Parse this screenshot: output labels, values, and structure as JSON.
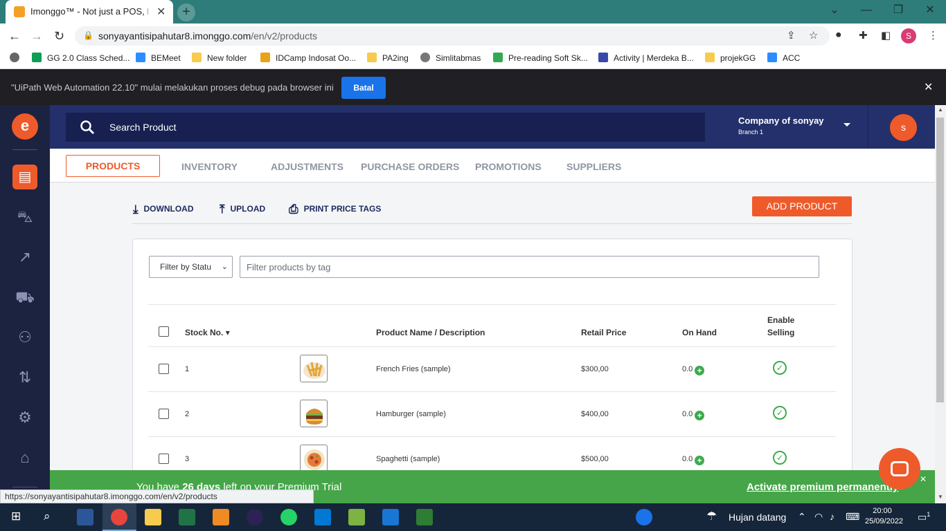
{
  "browser": {
    "tab_title": "Imonggo™ - Not just a POS, It's t",
    "url_main": "sonyayantisipahutar8.imonggo.com",
    "url_path": "/en/v2/products",
    "status_url": "https://sonyayantisipahutar8.imonggo.com/en/v2/products",
    "profile_initial": "S",
    "bookmarks": [
      {
        "label": "GG 2.0 Class Sched...",
        "color": "#0f9d58"
      },
      {
        "label": "BEMeet",
        "color": "#2d8cff"
      },
      {
        "label": "New folder",
        "color": "#f7cb4d"
      },
      {
        "label": "IDCamp Indosat Oo...",
        "color": "#e8a317"
      },
      {
        "label": "PA2ing",
        "color": "#f7cb4d"
      },
      {
        "label": "Simlitabmas",
        "color": "#777777"
      },
      {
        "label": "Pre-reading Soft Sk...",
        "color": "#34a853"
      },
      {
        "label": "Activity | Merdeka B...",
        "color": "#3949ab"
      },
      {
        "label": "projekGG",
        "color": "#f7cb4d"
      },
      {
        "label": "ACC",
        "color": "#2d8cff"
      }
    ]
  },
  "debug_bar": {
    "message": "\"UiPath Web Automation 22.10\" mulai melakukan proses debug pada browser ini",
    "cancel_label": "Batal"
  },
  "header": {
    "search_placeholder": "Search Product",
    "company": "Company of sonyay",
    "branch": "Branch 1",
    "avatar_initial": "s"
  },
  "nav_tabs": [
    "PRODUCTS",
    "INVENTORY",
    "ADJUSTMENTS",
    "PURCHASE ORDERS",
    "PROMOTIONS",
    "SUPPLIERS"
  ],
  "toolbar": {
    "download": "DOWNLOAD",
    "upload": "UPLOAD",
    "print": "PRINT PRICE TAGS",
    "add_product": "ADD PRODUCT"
  },
  "filters": {
    "status_value": "Filter by Statu",
    "tag_placeholder": "Filter products by tag"
  },
  "table": {
    "headers": {
      "stock_no": "Stock No.",
      "name": "Product Name / Description",
      "retail_price": "Retail Price",
      "on_hand": "On Hand",
      "enable_selling_1": "Enable",
      "enable_selling_2": "Selling"
    },
    "rows": [
      {
        "stock_no": "1",
        "name": "French Fries (sample)",
        "price": "$300,00",
        "on_hand": "0.0",
        "thumb_color": "#e3a63a"
      },
      {
        "stock_no": "2",
        "name": "Hamburger (sample)",
        "price": "$400,00",
        "on_hand": "0.0",
        "thumb_color": "#b5632c"
      },
      {
        "stock_no": "3",
        "name": "Spaghetti (sample)",
        "price": "$500,00",
        "on_hand": "0.0",
        "thumb_color": "#d9652e"
      }
    ]
  },
  "premium": {
    "prefix": "You have ",
    "days": "26 days",
    "suffix": " left on your Premium Trial",
    "activate": "Activate premium permanently"
  },
  "taskbar": {
    "weather": "Hujan datang",
    "time": "20:00",
    "date": "25/09/2022",
    "notification_count": "1"
  }
}
